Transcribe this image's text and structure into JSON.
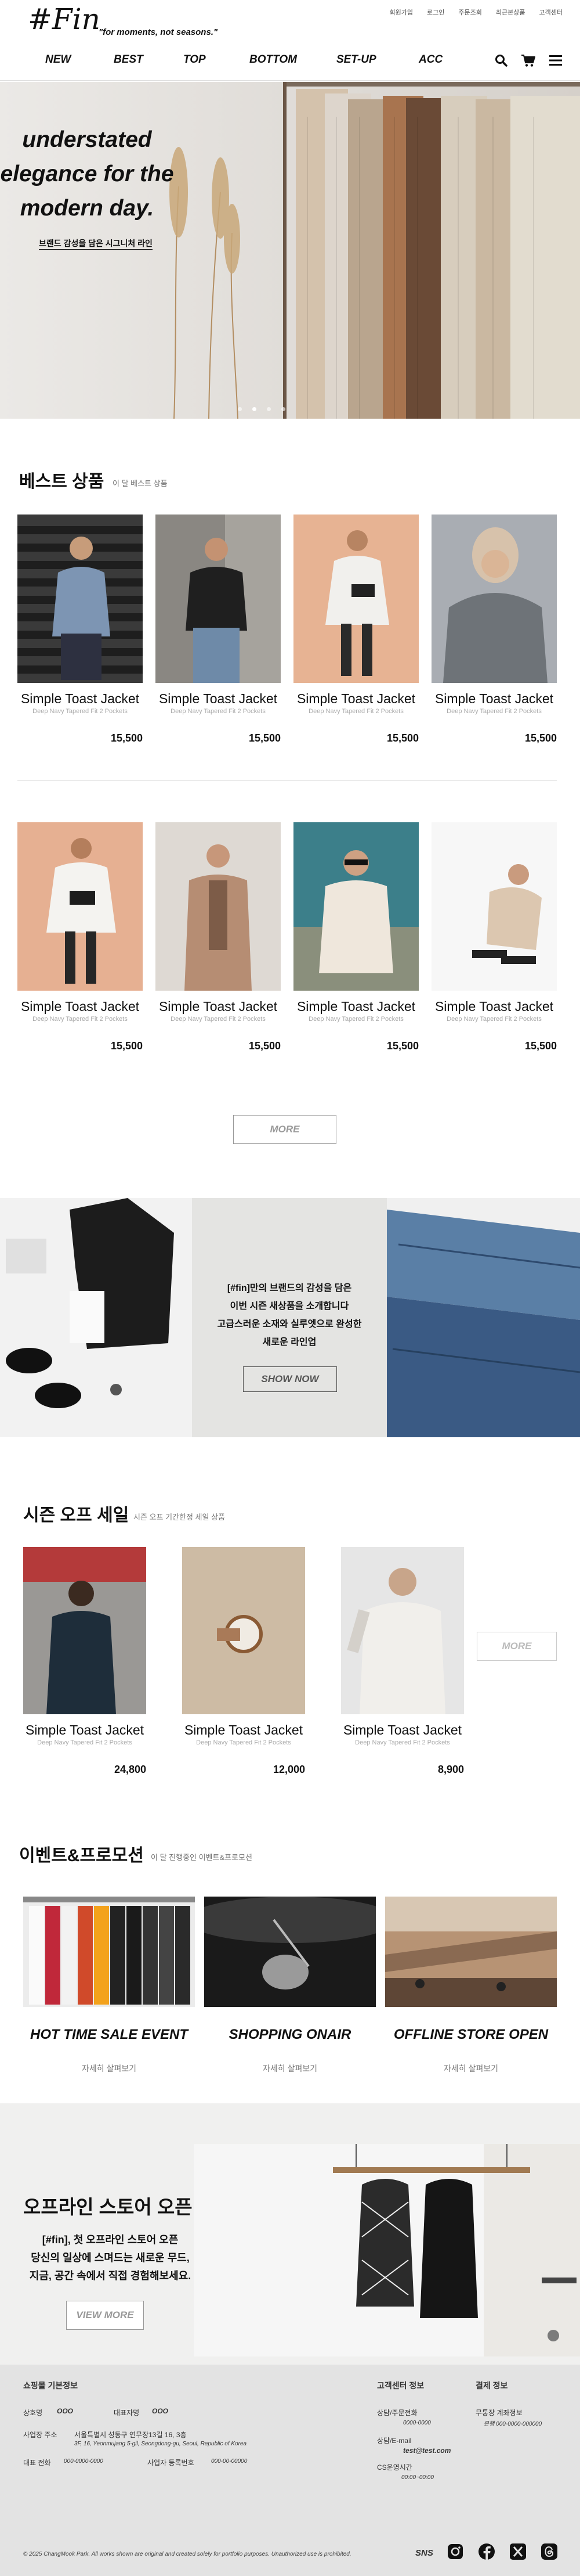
{
  "header": {
    "logo": "#Fin",
    "tagline": "\"for moments, not seasons.\"",
    "util_links": [
      "회원가입",
      "로그인",
      "주문조회",
      "최근본상품",
      "고객센터"
    ],
    "nav": [
      "NEW",
      "BEST",
      "TOP",
      "BOTTOM",
      "SET-UP",
      "ACC"
    ]
  },
  "hero": {
    "line1": "understated",
    "line2": "elegance for the",
    "line3": "modern day.",
    "subtitle": "브랜드 감성을 담은 시그니처 라인",
    "slide_count": 4,
    "active_slide": 1
  },
  "best": {
    "title": "베스트 상품",
    "subtitle": "이 달 베스트 상품",
    "products": [
      {
        "name": "Simple Toast Jacket",
        "desc": "Deep Navy Tapered Fit 2 Pockets",
        "price": "15,500"
      },
      {
        "name": "Simple Toast Jacket",
        "desc": "Deep Navy Tapered Fit 2 Pockets",
        "price": "15,500"
      },
      {
        "name": "Simple Toast Jacket",
        "desc": "Deep Navy Tapered Fit 2 Pockets",
        "price": "15,500"
      },
      {
        "name": "Simple Toast Jacket",
        "desc": "Deep Navy Tapered Fit 2 Pockets",
        "price": "15,500"
      },
      {
        "name": "Simple Toast Jacket",
        "desc": "Deep Navy Tapered Fit 2 Pockets",
        "price": "15,500"
      },
      {
        "name": "Simple Toast Jacket",
        "desc": "Deep Navy Tapered Fit 2 Pockets",
        "price": "15,500"
      },
      {
        "name": "Simple Toast Jacket",
        "desc": "Deep Navy Tapered Fit 2 Pockets",
        "price": "15,500"
      },
      {
        "name": "Simple Toast Jacket",
        "desc": "Deep Navy Tapered Fit 2 Pockets",
        "price": "15,500"
      }
    ],
    "more_label": "MORE"
  },
  "banner": {
    "line1": "[#fin]만의 브랜드의 감성을 담은",
    "line2": "이번 시즌 새상품을 소개합니다",
    "line3": "고급스러운 소재와 실루엣으로 완성한",
    "line4": "새로운 라인업",
    "button": "SHOW NOW"
  },
  "sale": {
    "title": "시즌 오프 세일",
    "subtitle": "시즌 오프 기간한정 세일 상품",
    "products": [
      {
        "name": "Simple Toast Jacket",
        "desc": "Deep Navy Tapered Fit 2 Pockets",
        "price": "24,800"
      },
      {
        "name": "Simple Toast Jacket",
        "desc": "Deep Navy Tapered Fit 2 Pockets",
        "price": "12,000"
      },
      {
        "name": "Simple Toast Jacket",
        "desc": "Deep Navy Tapered Fit 2 Pockets",
        "price": "8,900"
      }
    ],
    "more_label": "MORE"
  },
  "events": {
    "title": "이벤트&프로모션",
    "subtitle": "이 달 진행중인 이벤트&프로모션",
    "items": [
      {
        "title": "HOT TIME SALE EVENT",
        "link": "자세히 살펴보기"
      },
      {
        "title": "SHOPPING ONAIR",
        "link": "자세히 살펴보기"
      },
      {
        "title": "OFFLINE  STORE OPEN",
        "link": "자세히 살펴보기"
      }
    ]
  },
  "offline": {
    "title": "오프라인 스토어 오픈",
    "line1": "[#fin], 첫 오프라인 스토어 오픈",
    "line2": "당신의 일상에 스며드는 새로운 무드,",
    "line3": "지금, 공간 속에서 직접 경험해보세요.",
    "button": "VIEW MORE"
  },
  "footer": {
    "shop_title": "쇼핑몰 기본정보",
    "company_label": "상호명",
    "company_value": "OOO",
    "ceo_label": "대표자명",
    "ceo_value": "OOO",
    "address_label": "사업장 주소",
    "address_value": "서울특별시 성동구 연무장13길 16, 3층",
    "address_en": "3F, 16, Yeonmujang 5-gil, Seongdong-gu, Seoul, Republic of Korea",
    "phone_label": "대표 전화",
    "phone_value": "000-0000-0000",
    "bizno_label": "사업자 등록번호",
    "bizno_value": "000-00-00000",
    "cs_title": "고객센터 정보",
    "cs_phone_label": "상담/주문전화",
    "cs_phone_value": "0000-0000",
    "cs_email_label": "상담/E-mail",
    "cs_email_value": "test@test.com",
    "cs_hours_label": "CS운영시간",
    "cs_hours_value": "00:00~00:00",
    "pay_title": "결제 정보",
    "pay_account_label": "무통장 계좌정보",
    "pay_account_value": "은행 000-0000-000000",
    "copyright": "© 2025 ChangMook Park. All works shown are original and created solely for portfolio purposes. Unauthorized use is prohibited.",
    "sns_label": "SNS",
    "sns_icons": [
      "instagram-icon",
      "facebook-icon",
      "x-icon",
      "threads-icon"
    ]
  },
  "colors": {
    "text": "#111111",
    "muted": "#999999",
    "footer_bg": "#e3e3e3",
    "banner_bg": "#e4e4e2"
  }
}
